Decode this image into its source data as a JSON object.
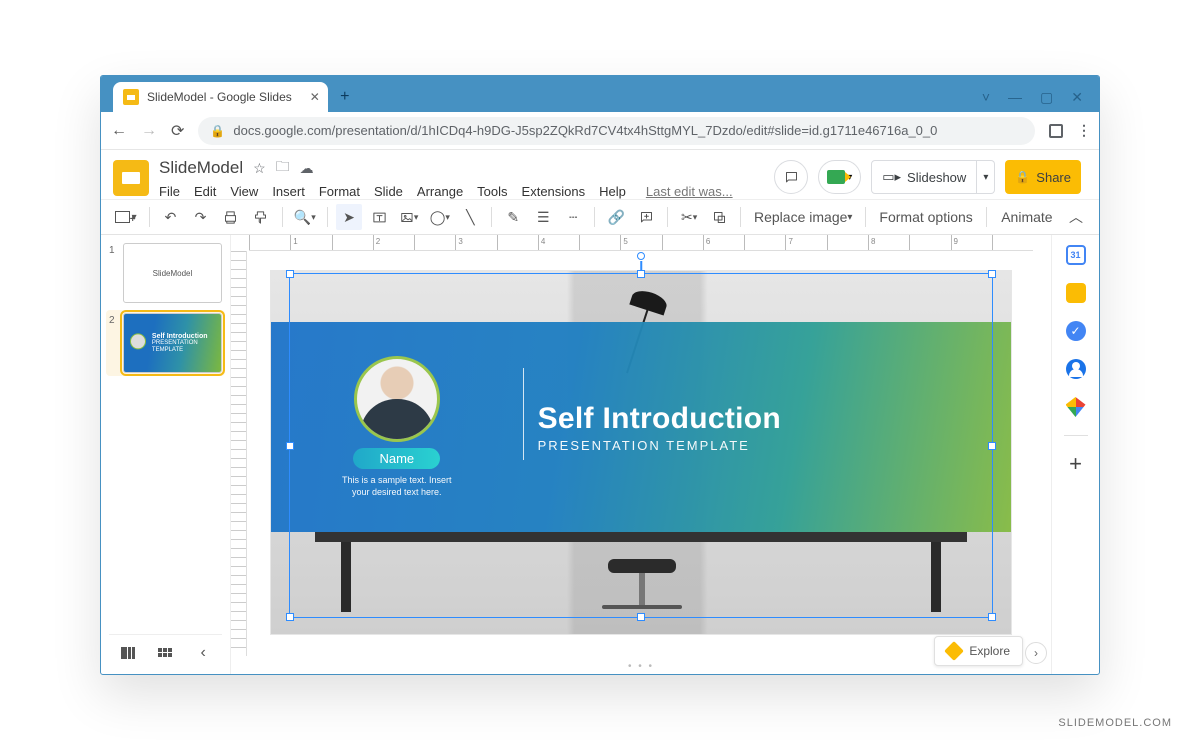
{
  "watermark": "SLIDEMODEL.COM",
  "browser": {
    "tab_title": "SlideModel - Google Slides",
    "url": "docs.google.com/presentation/d/1hICDq4-h9DG-J5sp2ZQkRd7CV4tx4hSttgMYL_7Dzdo/edit#slide=id.g1711e46716a_0_0"
  },
  "doc": {
    "title": "SlideModel",
    "menus": [
      "File",
      "Edit",
      "View",
      "Insert",
      "Format",
      "Slide",
      "Arrange",
      "Tools",
      "Extensions",
      "Help"
    ],
    "last_edit": "Last edit was...",
    "slideshow": "Slideshow",
    "share": "Share"
  },
  "toolbar": {
    "replace_image": "Replace image",
    "format_options": "Format options",
    "animate": "Animate"
  },
  "ruler_marks": [
    "",
    "1",
    "",
    "2",
    "",
    "3",
    "",
    "4",
    "",
    "5",
    "",
    "6",
    "",
    "7",
    "",
    "8",
    "",
    "9",
    ""
  ],
  "thumbs": {
    "t1_num": "1",
    "t1_text": "SlideModel",
    "t2_num": "2",
    "t2_title": "Self Introduction",
    "t2_sub": "PRESENTATION TEMPLATE"
  },
  "slide": {
    "heading": "Self Introduction",
    "sub": "PRESENTATION TEMPLATE",
    "name_label": "Name",
    "sample1": "This is a sample text. Insert",
    "sample2": "your desired text here."
  },
  "explore": "Explore"
}
